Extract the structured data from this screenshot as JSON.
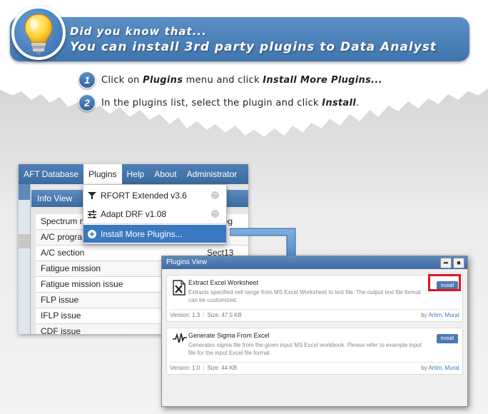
{
  "tip": {
    "line1": "Did you know that...",
    "line2": "You can install 3rd party plugins to Data Analyst"
  },
  "steps": [
    {
      "num": "1",
      "before": "Click on ",
      "b1": "Plugins",
      "middle": " menu and click ",
      "b2": "Install More Plugins...",
      "after": ""
    },
    {
      "num": "2",
      "before": "In the plugins list, select the plugin and click ",
      "b1": "Install",
      "middle": ".",
      "b2": "",
      "after": ""
    }
  ],
  "menubar": {
    "items": [
      "AFT Database",
      "Plugins",
      "Help",
      "About",
      "Administrator"
    ],
    "active": "Plugins"
  },
  "info_tab": "Info View",
  "info_rows": [
    {
      "key": "Spectrum n",
      "value": "Microg"
    },
    {
      "key": "A/C progra",
      "value": ""
    },
    {
      "key": "A/C section",
      "value": "Sect13"
    },
    {
      "key": "Fatigue mission",
      "value": ""
    },
    {
      "key": "Fatigue mission issue",
      "value": ""
    },
    {
      "key": "FLP issue",
      "value": ""
    },
    {
      "key": "IFLP issue",
      "value": ""
    },
    {
      "key": "CDF issue",
      "value": ""
    }
  ],
  "dropdown": {
    "items": [
      {
        "label": "RFORT Extended v3.6",
        "icon": "filter-icon"
      },
      {
        "label": "Adapt DRF v1.08",
        "icon": "sliders-icon"
      },
      {
        "label": "Install More Plugins...",
        "icon": "plus-circle-icon"
      }
    ]
  },
  "plugins_view": {
    "title": "Plugins View",
    "plugins": [
      {
        "name": "Extract Excel Worksheet",
        "description": "Extracts specified cell range from MS Excel Worksheet to text file. The output text file format can be customized.",
        "install_label": "Install",
        "version": "Version: 1.3",
        "size": "Size: 47.5 KB",
        "by": "by",
        "author": "Artim, Murat",
        "icon": "excel-x-icon"
      },
      {
        "name": "Generate Sigma From Excel",
        "description": "Generates sigma file from the given input MS Excel workbook. Please refer to example input file for the input Excel file format.",
        "install_label": "Install",
        "version": "Version: 1.0",
        "size": "Size: 44 KB",
        "by": "by",
        "author": "Artim, Murat",
        "icon": "waveform-icon"
      }
    ]
  },
  "colors": {
    "banner": "#4a80bb",
    "menubar": "#4574aa",
    "highlight": "#3a78c2",
    "install_button": "#4a79b2",
    "callout_red": "#e0141e"
  }
}
